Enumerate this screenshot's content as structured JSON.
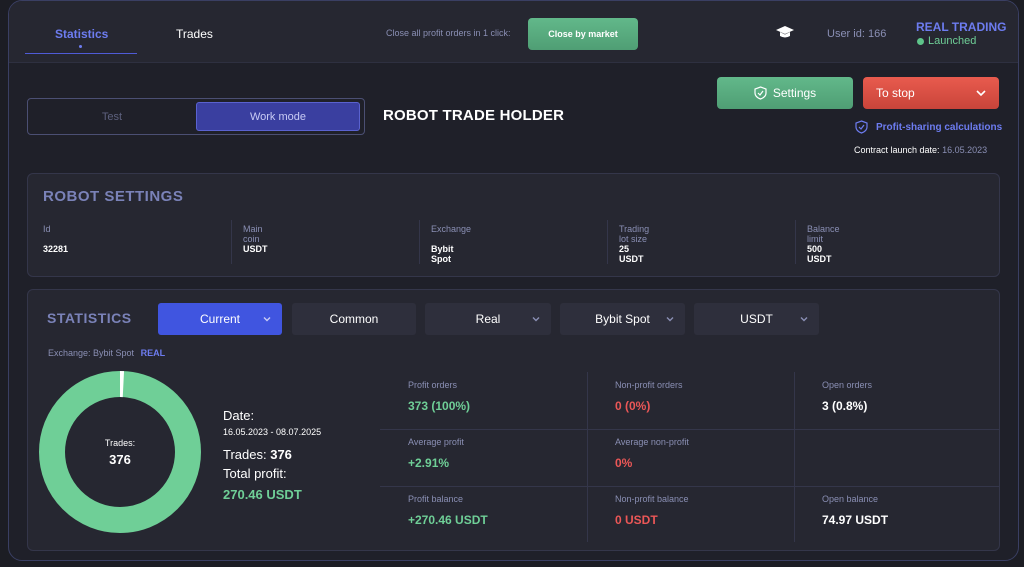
{
  "topbar": {
    "tabs": [
      "Statistics",
      "Trades"
    ],
    "close_all_text": "Close all profit orders in 1 click:",
    "close_by_market": "Close by market",
    "user_id": "User id: 166",
    "real_trading": "REAL TRADING",
    "status": "Launched"
  },
  "mode": {
    "test": "Test",
    "work": "Work mode"
  },
  "robot_title": "ROBOT TRADE HOLDER",
  "actions": {
    "settings": "Settings",
    "stop": "To stop",
    "profit_sharing": "Profit-sharing calculations",
    "contract_label": "Contract launch date:",
    "contract_date": "16.05.2023"
  },
  "robot_settings": {
    "title": "ROBOT SETTINGS",
    "fields": [
      {
        "label": "Id",
        "value": "32281"
      },
      {
        "label": "Main coin",
        "value": "USDT"
      },
      {
        "label": "Exchange",
        "value": "Bybit Spot"
      },
      {
        "label": "Trading lot size",
        "value": "25 USDT"
      },
      {
        "label": "Balance limit",
        "value": "500 USDT"
      }
    ]
  },
  "statistics": {
    "title": "STATISTICS",
    "filters": [
      "Current",
      "Common",
      "Real",
      "Bybit Spot",
      "USDT"
    ],
    "exchange_label": "Exchange: Bybit Spot",
    "exchange_mode": "REAL",
    "donut": {
      "label": "Trades:",
      "total": "376",
      "profit_fraction": 0.992,
      "profit_color": "#6fcf97",
      "open_color": "#ffffff"
    },
    "summary": {
      "date_label": "Date:",
      "date_range": "16.05.2023 - 08.07.2025",
      "trades_label": "Trades:",
      "trades_value": "376",
      "total_profit_label": "Total profit:",
      "total_profit_value": "270.46  USDT"
    },
    "metrics": [
      {
        "label": "Profit orders",
        "value": "373 (100%)",
        "color": "green"
      },
      {
        "label": "Non-profit orders",
        "value": "0 (0%)",
        "color": "red"
      },
      {
        "label": "Open orders",
        "value": "3 (0.8%)",
        "color": "white"
      },
      {
        "label": "Average profit",
        "value": "+2.91%",
        "color": "green"
      },
      {
        "label": "Average non-profit",
        "value": "0%",
        "color": "red"
      },
      {
        "label": "",
        "value": "",
        "color": "white"
      },
      {
        "label": "Profit balance",
        "value": "+270.46 USDT",
        "color": "green"
      },
      {
        "label": "Non-profit balance",
        "value": "0 USDT",
        "color": "red"
      },
      {
        "label": "Open balance",
        "value": "74.97 USDT",
        "color": "white"
      }
    ]
  }
}
